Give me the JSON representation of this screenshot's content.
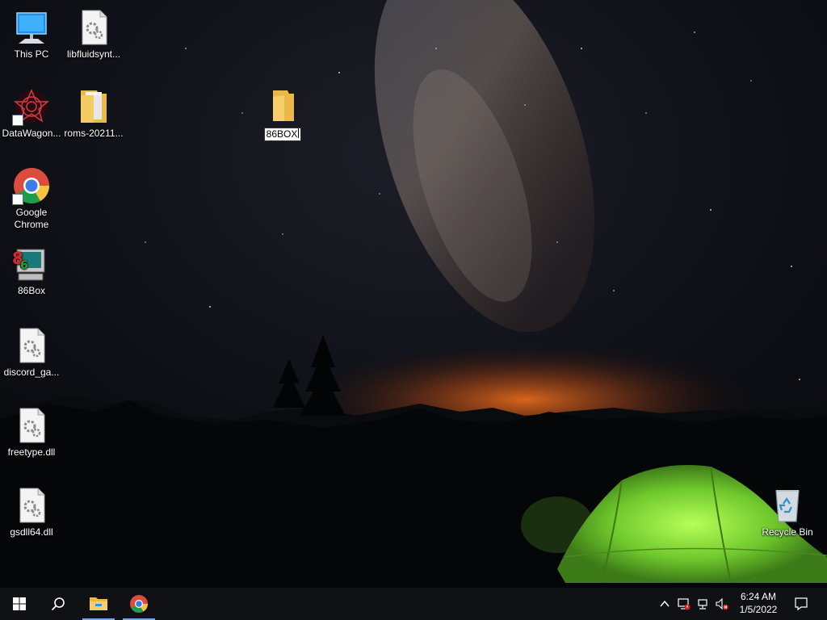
{
  "desktop": {
    "icons": [
      {
        "label": "This PC"
      },
      {
        "label": "libfluidsynt..."
      },
      {
        "label": "DataWagon..."
      },
      {
        "label": "roms-20211..."
      },
      {
        "label": "86BOX",
        "renaming": true
      },
      {
        "label": "Google Chrome"
      },
      {
        "label": "86Box"
      },
      {
        "label": "discord_ga..."
      },
      {
        "label": "freetype.dll"
      },
      {
        "label": "gsdll64.dll"
      },
      {
        "label": "Recycle Bin"
      }
    ]
  },
  "taskbar": {
    "start_icon": "windows-logo-icon",
    "search_icon": "search-icon",
    "pinned": [
      {
        "name": "file-explorer",
        "icon": "folder-icon"
      },
      {
        "name": "google-chrome",
        "icon": "chrome-icon"
      }
    ],
    "tray": {
      "icons": [
        "chevron-up-icon",
        "network-warning-icon",
        "network-disconnected-icon",
        "volume-muted-icon"
      ],
      "time": "6:24 AM",
      "date": "1/5/2022",
      "notification_icon": "action-center-icon"
    }
  },
  "colors": {
    "taskbar_bg": "#101114",
    "tent_green": "#7fd23a",
    "sunset_orange": "#d9561a",
    "active_indicator": "#7aa7e0"
  }
}
